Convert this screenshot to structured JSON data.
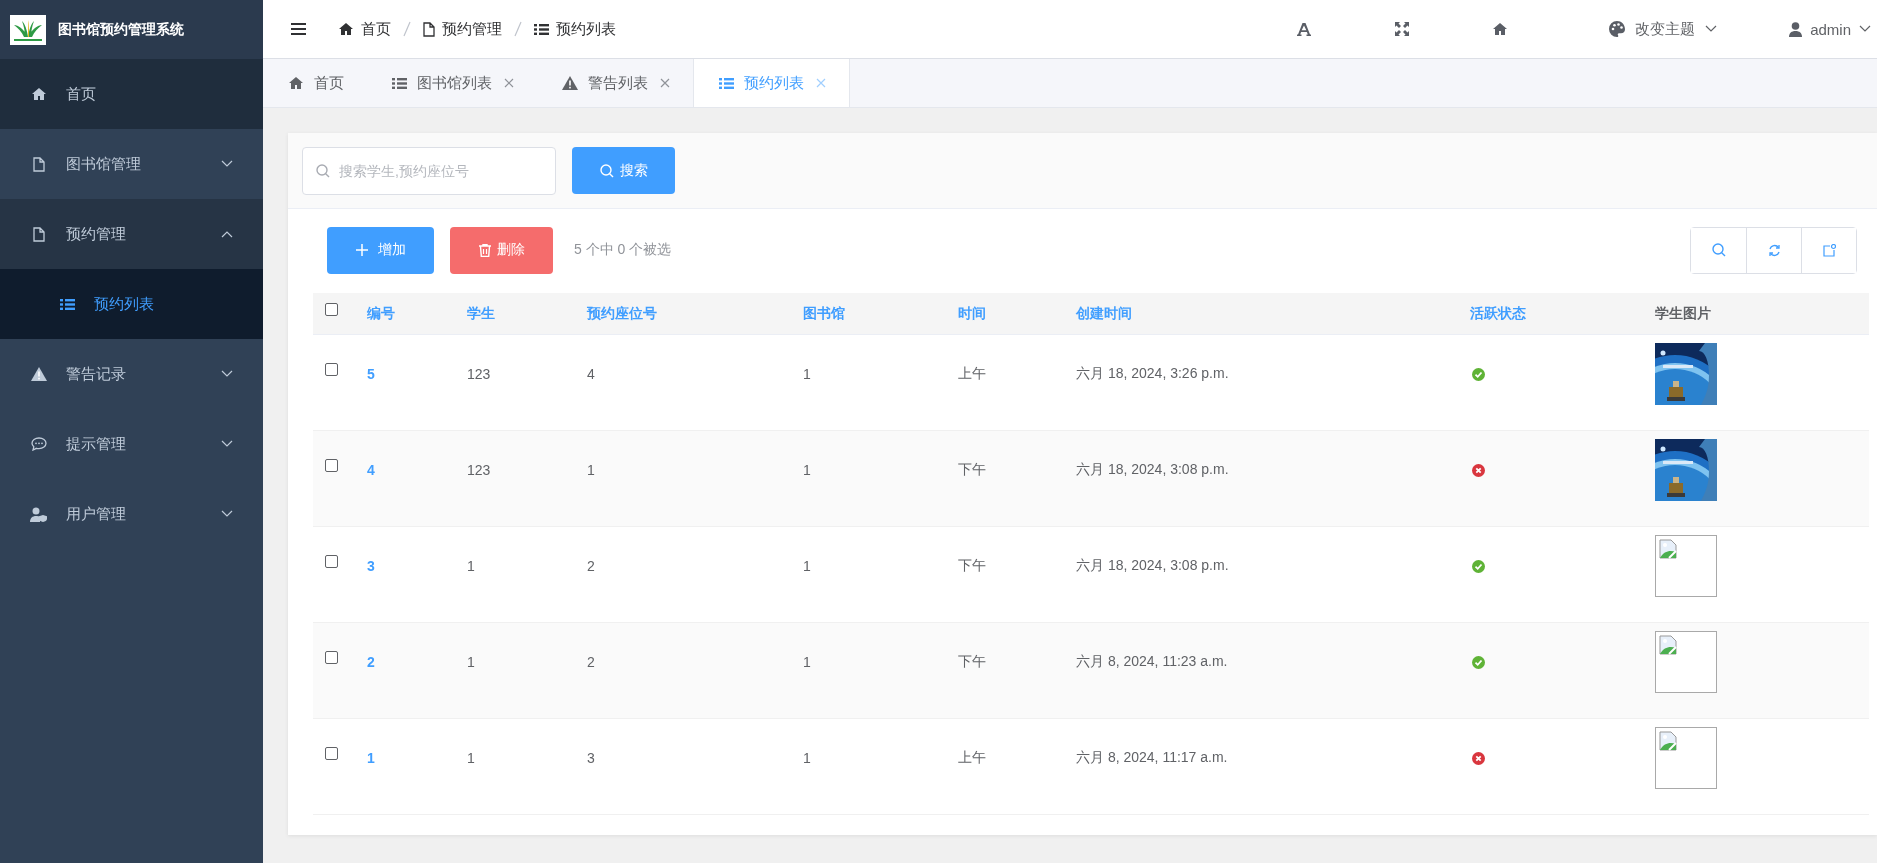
{
  "app": {
    "title": "图书馆预约管理系统"
  },
  "sidebar": {
    "items": [
      {
        "kind": "link",
        "label": "首页",
        "highlighted": true
      },
      {
        "kind": "group",
        "label": "图书馆管理",
        "highlighted": false,
        "expanded": false
      },
      {
        "kind": "group",
        "label": "预约管理",
        "highlighted": false,
        "expanded": true,
        "children": [
          {
            "label": "预约列表",
            "selected": true
          }
        ]
      },
      {
        "kind": "group",
        "label": "警告记录",
        "highlighted": false,
        "expanded": false
      },
      {
        "kind": "group",
        "label": "提示管理",
        "highlighted": false,
        "expanded": false
      },
      {
        "kind": "group",
        "label": "用户管理",
        "highlighted": false,
        "expanded": false
      }
    ]
  },
  "header": {
    "breadcrumb": [
      "首页",
      "预约管理",
      "预约列表"
    ],
    "theme": "改变主题",
    "user": "admin"
  },
  "tabs": [
    {
      "label": "首页",
      "closable": false,
      "selected": false
    },
    {
      "label": "图书馆列表",
      "closable": true,
      "selected": false
    },
    {
      "label": "警告列表",
      "closable": true,
      "selected": false
    },
    {
      "label": "预约列表",
      "closable": true,
      "selected": true
    }
  ],
  "search": {
    "placeholder": "搜索学生,预约座位号",
    "button": "搜索"
  },
  "toolbar": {
    "add": "增加",
    "delete": "删除",
    "selection": "5 个中 0 个被选"
  },
  "table": {
    "all_checked": false,
    "columns": [
      {
        "label": "编号",
        "sortable": true
      },
      {
        "label": "学生",
        "sortable": true
      },
      {
        "label": "预约座位号",
        "sortable": true
      },
      {
        "label": "图书馆",
        "sortable": true
      },
      {
        "label": "时间",
        "sortable": true
      },
      {
        "label": "创建时间",
        "sortable": true
      },
      {
        "label": "活跃状态",
        "sortable": true
      },
      {
        "label": "学生图片",
        "sortable": false
      }
    ],
    "rows": [
      {
        "checked": false,
        "id": "5",
        "student": "123",
        "seat": "4",
        "library": "1",
        "time": "上午",
        "created": "六月 18, 2024, 3:26 p.m.",
        "active": true
      },
      {
        "checked": false,
        "id": "4",
        "student": "123",
        "seat": "1",
        "library": "1",
        "time": "下午",
        "created": "六月 18, 2024, 3:08 p.m.",
        "active": false
      },
      {
        "checked": false,
        "id": "3",
        "student": "1",
        "seat": "2",
        "library": "1",
        "time": "下午",
        "created": "六月 18, 2024, 3:08 p.m.",
        "active": true,
        "image": {
          "kind": "broken"
        }
      },
      {
        "checked": false,
        "id": "2",
        "student": "1",
        "seat": "2",
        "library": "1",
        "time": "下午",
        "created": "六月 8, 2024, 11:23 a.m.",
        "active": true,
        "image": {
          "kind": "broken"
        }
      },
      {
        "checked": false,
        "id": "1",
        "student": "1",
        "seat": "3",
        "library": "1",
        "time": "上午",
        "created": "六月 8, 2024, 11:17 a.m.",
        "active": false,
        "image": {
          "kind": "broken"
        }
      }
    ]
  }
}
